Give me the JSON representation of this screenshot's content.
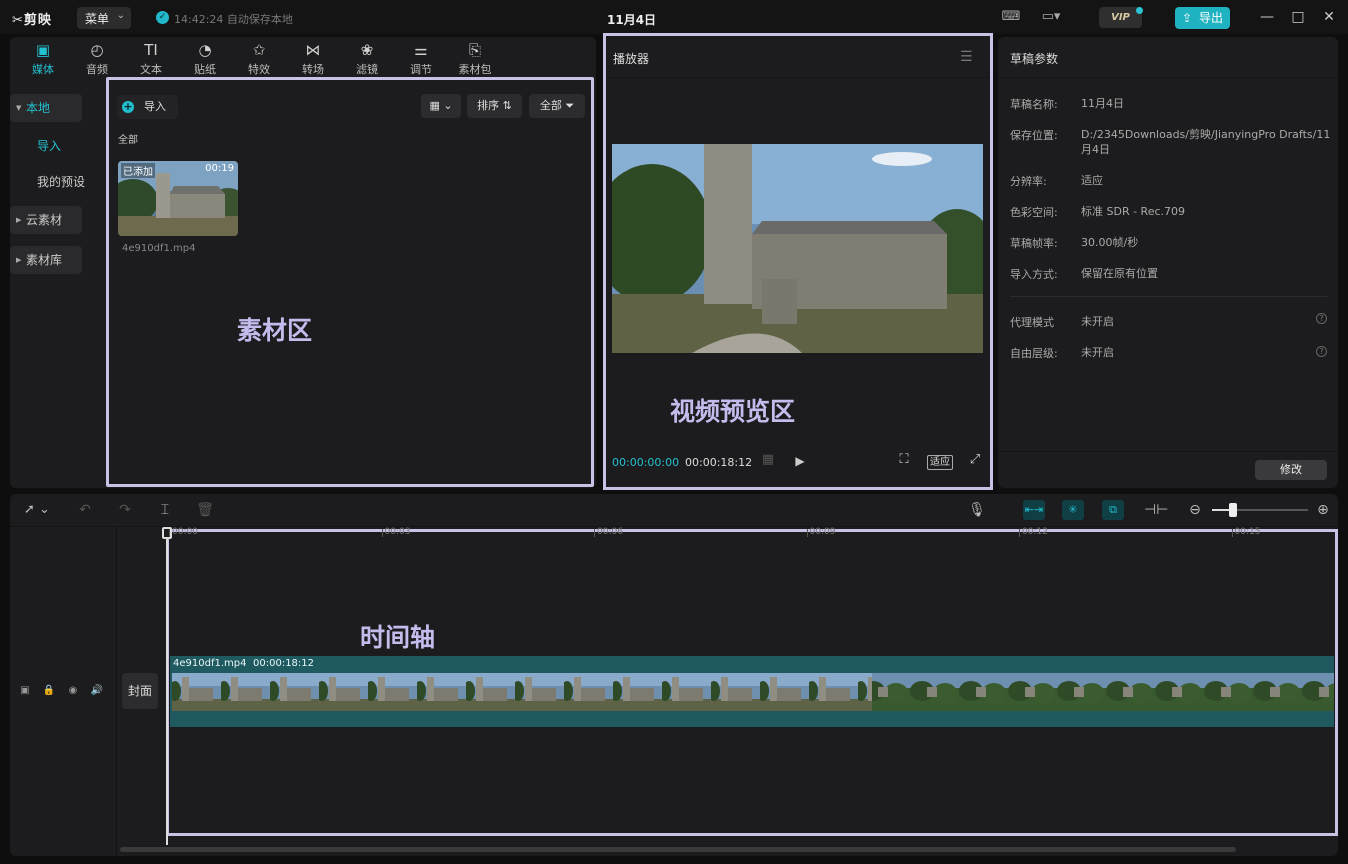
{
  "app": {
    "name": "剪映",
    "menu_label": "菜单",
    "autosave": "14:42:24 自动保存本地",
    "title": "11月4日",
    "vip": "VIP",
    "export_label": "导出"
  },
  "toolbar": [
    {
      "label": "媒体",
      "icon": "play-box-icon",
      "active": true
    },
    {
      "label": "音频",
      "icon": "audio-icon"
    },
    {
      "label": "文本",
      "icon": "text-icon"
    },
    {
      "label": "贴纸",
      "icon": "sticker-icon"
    },
    {
      "label": "特效",
      "icon": "effects-icon"
    },
    {
      "label": "转场",
      "icon": "transition-icon"
    },
    {
      "label": "滤镜",
      "icon": "filter-icon"
    },
    {
      "label": "调节",
      "icon": "adjust-icon"
    },
    {
      "label": "素材包",
      "icon": "asset-pack-icon"
    }
  ],
  "sidebar": {
    "local": "本地",
    "import": "导入",
    "presets": "我的预设",
    "cloud": "云素材",
    "library": "素材库"
  },
  "media": {
    "import_btn": "导入",
    "sort": "排序",
    "filter_all": "全部",
    "group_label": "全部",
    "items": [
      {
        "added": "已添加",
        "duration": "00:19",
        "filename": "4e910df1.mp4"
      }
    ],
    "zone_label": "素材区"
  },
  "player": {
    "title": "播放器",
    "current_time": "00:00:00:00",
    "total_time": "00:00:18:12",
    "fit_label": "适应",
    "zone_label": "视频预览区"
  },
  "params": {
    "title": "草稿参数",
    "rows": [
      {
        "key": "草稿名称:",
        "value": "11月4日"
      },
      {
        "key": "保存位置:",
        "value": "D:/2345Downloads/剪映/JianyingPro Drafts/11月4日"
      },
      {
        "key": "分辨率:",
        "value": "适应"
      },
      {
        "key": "色彩空间:",
        "value": "标准 SDR - Rec.709"
      },
      {
        "key": "草稿帧率:",
        "value": "30.00帧/秒"
      },
      {
        "key": "导入方式:",
        "value": "保留在原有位置"
      }
    ],
    "extra_rows": [
      {
        "key": "代理模式",
        "value": "未开启"
      },
      {
        "key": "自由层级:",
        "value": "未开启"
      }
    ],
    "modify": "修改"
  },
  "timeline": {
    "ruler": [
      "00:00",
      "00:03",
      "00:06",
      "00:09",
      "00:12",
      "00:15"
    ],
    "clip_name": "4e910df1.mp4",
    "clip_duration": "00:00:18:12",
    "cover": "封面",
    "zone_label": "时间轴",
    "zoom": 0.2
  },
  "colors": {
    "accent": "#23c0cf",
    "highlight_border": "#c8c2e6",
    "clip_bg": "#1f5a60"
  }
}
